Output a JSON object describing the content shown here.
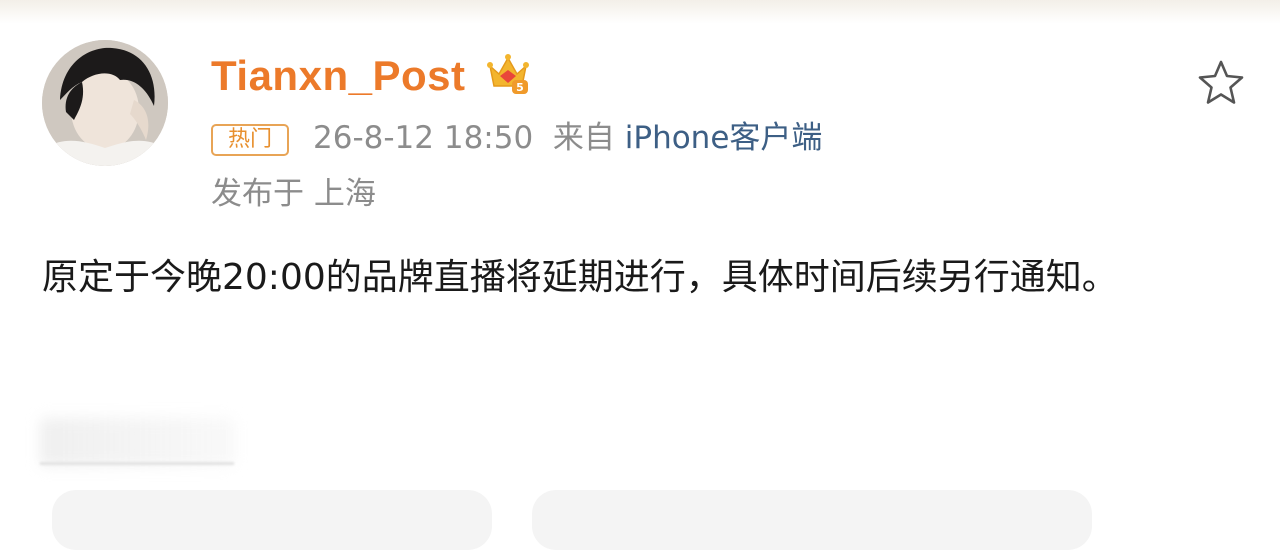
{
  "post": {
    "username": "Tianxn_Post",
    "badge_label": "热门",
    "timestamp": "26-8-12 18:50",
    "source_prefix": "来自",
    "source_device": "iPhone客户端",
    "location": "发布于 上海",
    "body": "原定于今晚20:00的品牌直播将延期进行，具体时间后续另行通知。",
    "vip_level": "5"
  },
  "icons": {
    "avatar": "avatar",
    "vip_crown": "crown-icon",
    "favorite": "star-icon"
  },
  "colors": {
    "username": "#ec7a2a",
    "badge": "#e8a456",
    "meta_text": "#8c8c8c",
    "device_link": "#3d5f85",
    "body_text": "#1a1a1a"
  }
}
